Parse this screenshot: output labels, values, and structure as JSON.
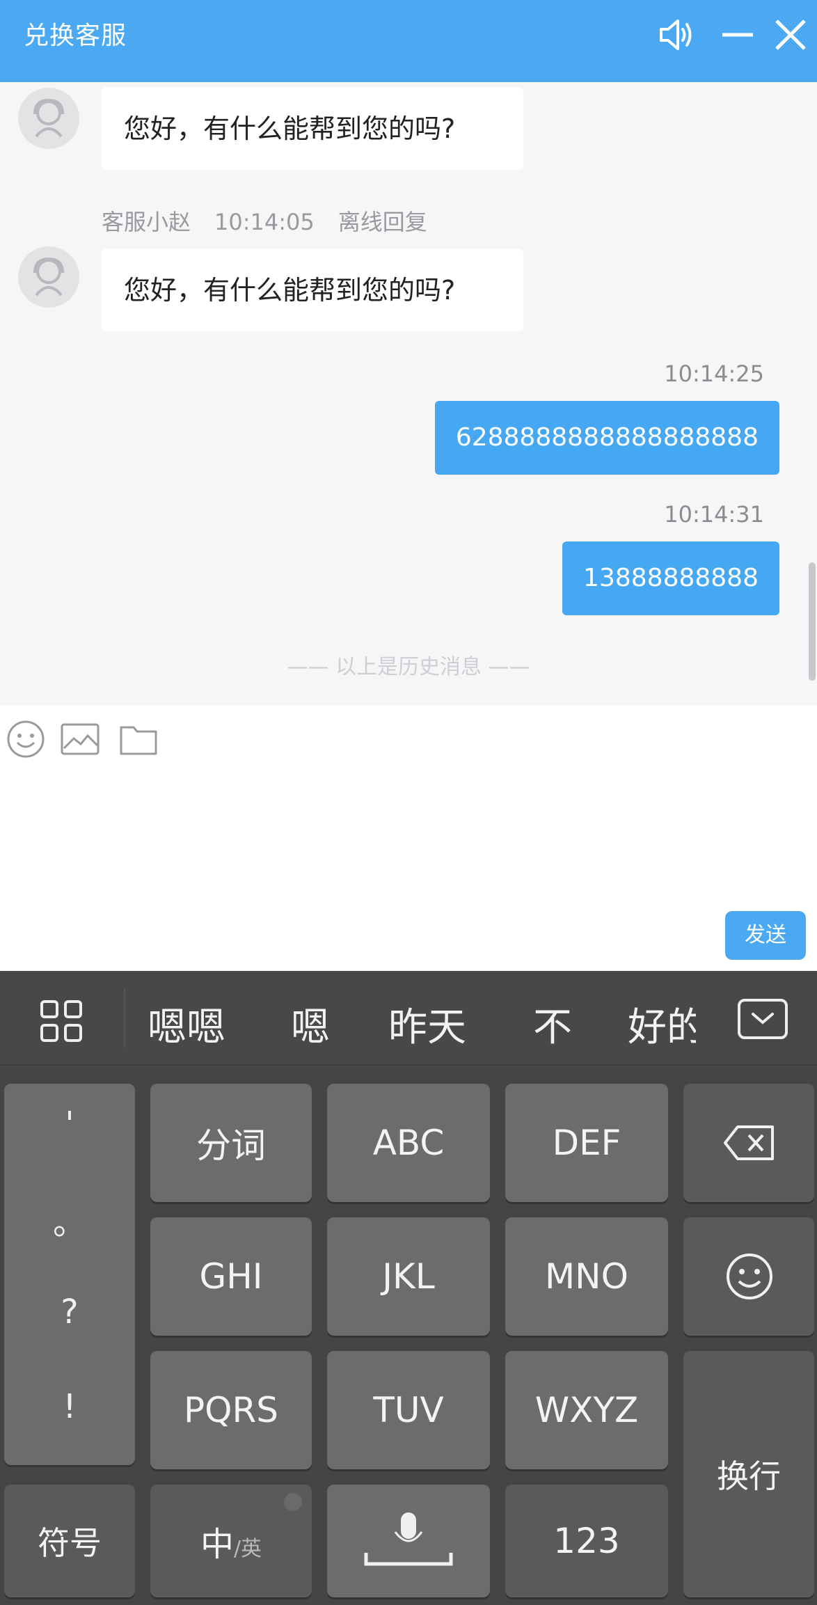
{
  "header": {
    "title": "兑换客服"
  },
  "chat": {
    "messages_in": [
      {
        "text": "您好，有什么能帮到您的吗?"
      },
      {
        "agent": "客服小赵",
        "time": "10:14:05",
        "status": "离线回复",
        "text": "您好，有什么能帮到您的吗?"
      }
    ],
    "messages_out": [
      {
        "time": "10:14:25",
        "text": "6288888888888888888"
      },
      {
        "time": "10:14:31",
        "text": "13888888888"
      }
    ],
    "history_divider": "—— 以上是历史消息 ——"
  },
  "input": {
    "send_label": "发送"
  },
  "keyboard": {
    "candidates": [
      "嗯嗯",
      "嗯",
      "昨天",
      "不",
      "好的"
    ],
    "punctuation": [
      "'",
      "。",
      "?",
      "!"
    ],
    "keys": {
      "fenci": "分词",
      "abc": "ABC",
      "def": "DEF",
      "ghi": "GHI",
      "jkl": "JKL",
      "mno": "MNO",
      "pqrs": "PQRS",
      "tuv": "TUV",
      "wxyz": "WXYZ",
      "symbols": "符号",
      "lang_zh": "中",
      "lang_en": "/英",
      "num": "123",
      "enter": "换行"
    },
    "icons": [
      "grid-icon",
      "keyboard-hide-icon",
      "backspace-icon",
      "emoji-icon",
      "microphone-icon"
    ]
  },
  "colors": {
    "accent": "#4aa9f2",
    "bubble_out": "#46a8f2",
    "keyboard_bg": "#454545",
    "key_bg": "#6c6c6c"
  }
}
